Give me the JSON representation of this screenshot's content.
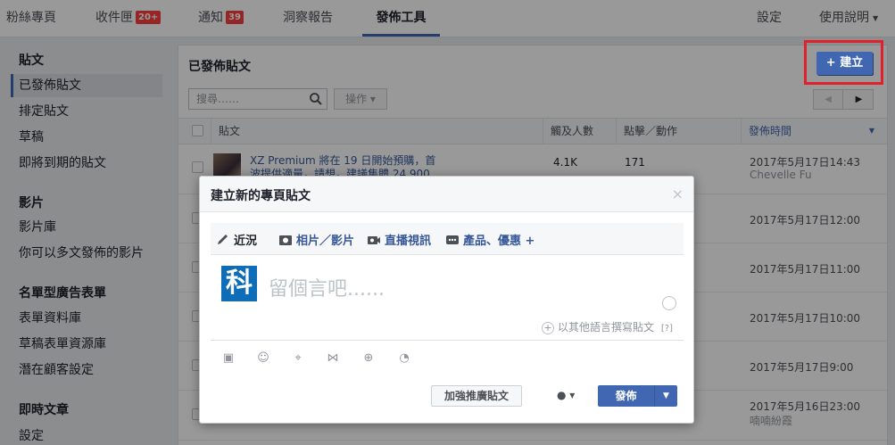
{
  "topnav": {
    "items": [
      {
        "label": "粉絲專頁"
      },
      {
        "label": "收件匣",
        "badge": "20+"
      },
      {
        "label": "通知",
        "badge": "39"
      },
      {
        "label": "洞察報告"
      },
      {
        "label": "發佈工具"
      }
    ],
    "settings": "設定",
    "help": "使用說明",
    "help_caret": "▼"
  },
  "sidebar": {
    "sections": [
      {
        "heading": "貼文",
        "items": [
          "已發佈貼文",
          "排定貼文",
          "草稿",
          "即將到期的貼文"
        ]
      },
      {
        "heading": "影片",
        "items": [
          "影片庫",
          "你可以多文發佈的影片"
        ]
      },
      {
        "heading": "名單型廣告表單",
        "items": [
          "表單資料庫",
          "草稿表單資源庫",
          "潛在顧客設定"
        ]
      },
      {
        "heading": "即時文章",
        "items": [
          "設定"
        ]
      }
    ]
  },
  "main": {
    "title": "已發佈貼文",
    "create_button": "+ 建立",
    "search_placeholder": "搜尋……",
    "ops_button": "操作 ▾",
    "pager_prev": "◀",
    "pager_next": "▶",
    "columns": [
      "貼文",
      "觸及人數",
      "點擊／動作",
      "發佈時間"
    ],
    "rows": [
      {
        "text": "XZ Premium 將在 19 日開始預購，首",
        "text2": "波提供適量，請想，建議集體 24,900",
        "reach": "4.1K",
        "clicks": "171",
        "time": "2017年5月17日14:43",
        "author": "Chevelle Fu"
      },
      {
        "time": "2017年5月17日12:00"
      },
      {
        "time": "2017年5月17日11:00"
      },
      {
        "time": "2017年5月17日10:00"
      },
      {
        "time": "2017年5月17日9:00"
      },
      {
        "time": "2017年5月16日23:00",
        "author": "喃喃紛霞"
      }
    ]
  },
  "dialog": {
    "title": "建立新的專頁貼文",
    "close": "×",
    "tabs": [
      "近況",
      "相片／影片",
      "直播視訊",
      "產品、優惠 +"
    ],
    "logo_char": "科",
    "placeholder": "留個言吧......",
    "lang_link": "以其他語言撰寫貼文",
    "lang_help": "[?]",
    "boost_button": "加強推廣貼文",
    "globe": "● ▾",
    "publish_button": "發佈",
    "publish_caret": "▼"
  },
  "colors": {
    "brand": "#4267b2",
    "badge": "#fa3e3e",
    "highlight_box": "#e0202a"
  }
}
